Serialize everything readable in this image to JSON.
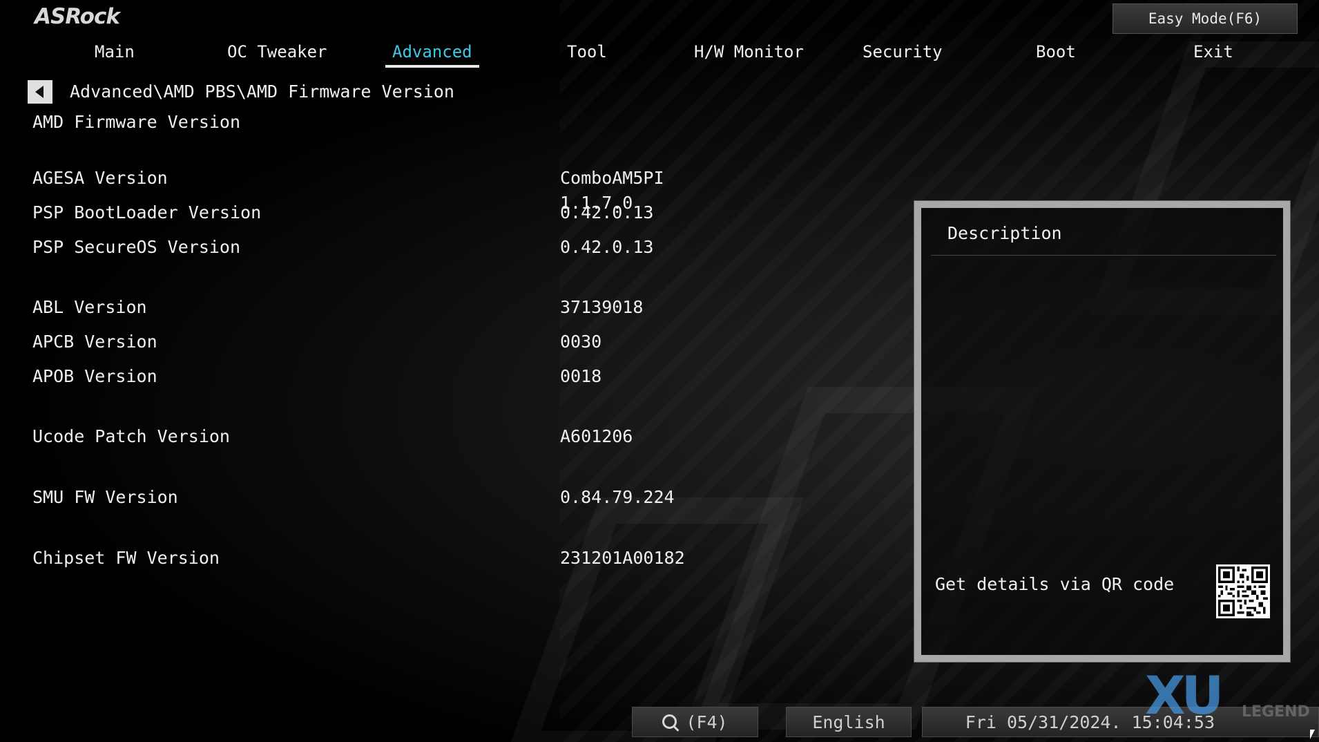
{
  "brand": {
    "logo_text": "ASRock"
  },
  "header": {
    "easy_mode_label": "Easy Mode(F6)"
  },
  "nav": {
    "tabs": [
      {
        "label": "Main"
      },
      {
        "label": "OC Tweaker"
      },
      {
        "label": "Advanced",
        "active": true
      },
      {
        "label": "Tool"
      },
      {
        "label": "H/W Monitor"
      },
      {
        "label": "Security"
      },
      {
        "label": "Boot"
      },
      {
        "label": "Exit"
      }
    ]
  },
  "page": {
    "breadcrumb": "Advanced\\AMD PBS\\AMD Firmware Version",
    "title": "AMD Firmware Version",
    "rows": [
      {
        "label": "AGESA Version",
        "value": "ComboAM5PI 1.1.7.0"
      },
      {
        "label": "PSP BootLoader Version",
        "value": "0.42.0.13"
      },
      {
        "label": "PSP SecureOS Version",
        "value": "0.42.0.13"
      },
      {
        "label": "ABL Version",
        "value": "37139018"
      },
      {
        "label": "APCB Version",
        "value": "0030"
      },
      {
        "label": "APOB Version",
        "value": "0018"
      },
      {
        "label": "Ucode Patch Version",
        "value": "A601206"
      },
      {
        "label": "SMU FW Version",
        "value": "0.84.79.224"
      },
      {
        "label": "Chipset FW Version",
        "value": "231201A00182"
      }
    ]
  },
  "description": {
    "title": "Description",
    "qr_label": "Get details via QR code"
  },
  "footer": {
    "search_label": "(F4)",
    "language": "English",
    "datetime": "Fri 05/31/2024. 15:04:53"
  },
  "watermark": {
    "main": "XU",
    "sub": "LEGEND"
  },
  "colors": {
    "accent": "#3fc8e6",
    "text": "#f0f0f0",
    "panel_border": "#a8a8a8",
    "background": "#000000"
  },
  "icons": {
    "back": "chevron-left-icon",
    "search": "search-icon",
    "qr": "qr-code-icon",
    "cursor": "mouse-cursor-icon"
  }
}
